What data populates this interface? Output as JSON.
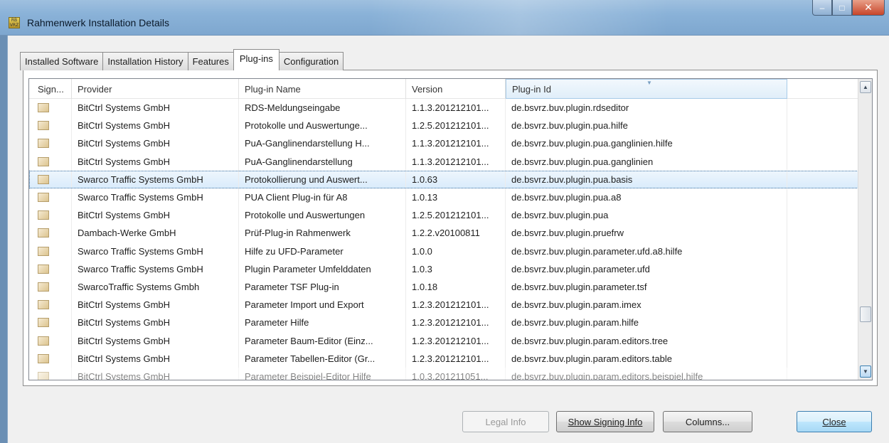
{
  "window": {
    "icon_text": "RB VRZ",
    "title": "Rahmenwerk Installation Details",
    "minimize_glyph": "–",
    "maximize_glyph": "□",
    "close_glyph": "✕"
  },
  "tabs": [
    {
      "label": "Installed Software",
      "active": false
    },
    {
      "label": "Installation History",
      "active": false
    },
    {
      "label": "Features",
      "active": false
    },
    {
      "label": "Plug-ins",
      "active": true
    },
    {
      "label": "Configuration",
      "active": false
    }
  ],
  "table": {
    "columns": [
      "Sign...",
      "Provider",
      "Plug-in Name",
      "Version",
      "Plug-in Id"
    ],
    "sorted_column": "Plug-in Id",
    "rows": [
      {
        "provider": "BitCtrl Systems GmbH",
        "name": "RDS-Meldungseingabe",
        "version": "1.1.3.201212101...",
        "id": "de.bsvrz.buv.plugin.rdseditor"
      },
      {
        "provider": "BitCtrl Systems GmbH",
        "name": "Protokolle und Auswertunge...",
        "version": "1.2.5.201212101...",
        "id": "de.bsvrz.buv.plugin.pua.hilfe"
      },
      {
        "provider": "BitCtrl Systems GmbH",
        "name": "PuA-Ganglinendarstellung H...",
        "version": "1.1.3.201212101...",
        "id": "de.bsvrz.buv.plugin.pua.ganglinien.hilfe"
      },
      {
        "provider": "BitCtrl Systems GmbH",
        "name": "PuA-Ganglinendarstellung",
        "version": "1.1.3.201212101...",
        "id": "de.bsvrz.buv.plugin.pua.ganglinien"
      },
      {
        "provider": "Swarco Traffic Systems GmbH",
        "name": "Protokollierung und Auswert...",
        "version": "1.0.63",
        "id": "de.bsvrz.buv.plugin.pua.basis",
        "selected": true
      },
      {
        "provider": "Swarco Traffic Systems GmbH",
        "name": "PUA Client Plug-in für A8",
        "version": "1.0.13",
        "id": "de.bsvrz.buv.plugin.pua.a8"
      },
      {
        "provider": "BitCtrl Systems GmbH",
        "name": "Protokolle und Auswertungen",
        "version": "1.2.5.201212101...",
        "id": "de.bsvrz.buv.plugin.pua"
      },
      {
        "provider": "Dambach-Werke GmbH",
        "name": "Prüf-Plug-in Rahmenwerk",
        "version": "1.2.2.v20100811",
        "id": "de.bsvrz.buv.plugin.pruefrw"
      },
      {
        "provider": "Swarco Traffic Systems GmbH",
        "name": "Hilfe zu UFD-Parameter",
        "version": "1.0.0",
        "id": "de.bsvrz.buv.plugin.parameter.ufd.a8.hilfe"
      },
      {
        "provider": "Swarco Traffic Systems GmbH",
        "name": "Plugin Parameter Umfelddaten",
        "version": "1.0.3",
        "id": "de.bsvrz.buv.plugin.parameter.ufd"
      },
      {
        "provider": "SwarcoTraffic Systems Gmbh",
        "name": "Parameter TSF Plug-in",
        "version": "1.0.18",
        "id": "de.bsvrz.buv.plugin.parameter.tsf"
      },
      {
        "provider": "BitCtrl Systems GmbH",
        "name": "Parameter Import und Export",
        "version": "1.2.3.201212101...",
        "id": "de.bsvrz.buv.plugin.param.imex"
      },
      {
        "provider": "BitCtrl Systems GmbH",
        "name": "Parameter Hilfe",
        "version": "1.2.3.201212101...",
        "id": "de.bsvrz.buv.plugin.param.hilfe"
      },
      {
        "provider": "BitCtrl Systems GmbH",
        "name": "Parameter Baum-Editor (Einz...",
        "version": "1.2.3.201212101...",
        "id": "de.bsvrz.buv.plugin.param.editors.tree"
      },
      {
        "provider": "BitCtrl Systems GmbH",
        "name": "Parameter Tabellen-Editor (Gr...",
        "version": "1.2.3.201212101...",
        "id": "de.bsvrz.buv.plugin.param.editors.table"
      },
      {
        "provider": "BitCtrl Systems GmbH",
        "name": "Parameter Beispiel-Editor Hilfe",
        "version": "1.0.3.201211051...",
        "id": "de.bsvrz.buv.plugin.param.editors.beispiel.hilfe",
        "partial": true
      }
    ]
  },
  "buttons": {
    "legal_info": {
      "label": "Legal Info",
      "enabled": false
    },
    "show_signing_info": {
      "label": "Show Signing Info",
      "enabled": true
    },
    "columns": {
      "label": "Columns...",
      "enabled": true
    },
    "close": {
      "label": "Close",
      "enabled": true,
      "default": true
    }
  },
  "icons": {
    "signature": "signature-icon",
    "scroll_up": "▲",
    "scroll_down": "▼",
    "sort_indicator": "▼"
  },
  "colors": {
    "titlebar": "#8ab2d8",
    "selection": "#d9ebfb",
    "close_button": "#c7452a",
    "default_button": "#a7d9f5"
  }
}
